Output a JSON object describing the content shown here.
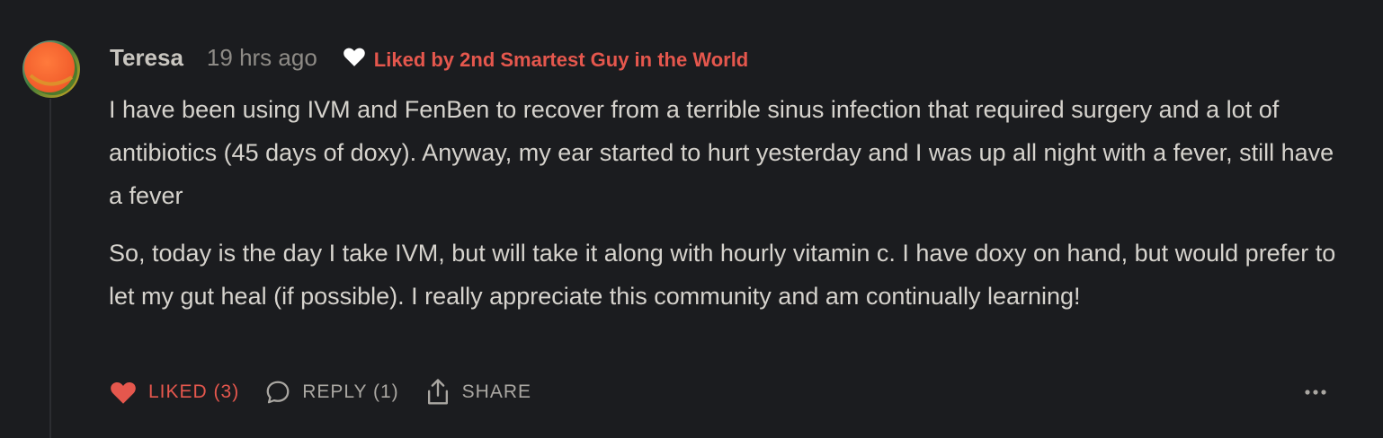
{
  "comment": {
    "author": "Teresa",
    "timestamp": "19 hrs ago",
    "liked_by": "Liked by 2nd Smartest Guy in the World",
    "paragraphs": [
      "I have been using IVM and FenBen to recover from a terrible sinus infection that required surgery and a lot of antibiotics (45 days of doxy). Anyway, my ear started to hurt yesterday and I was up all night with a fever, still have a fever",
      "So, today is the day I take IVM, but will take it along with hourly vitamin c. I have doxy on hand, but would prefer to let my gut heal (if possible). I really appreciate this community and am continually learning!"
    ]
  },
  "actions": {
    "like_label": "LIKED (3)",
    "reply_label": "REPLY (1)",
    "share_label": "SHARE"
  },
  "icons": {
    "avatar": "avatar-gradient-circle",
    "liked_by": "heart-outline-icon",
    "like": "heart-filled-icon",
    "reply": "speech-bubble-icon",
    "share": "share-upload-icon",
    "more": "ellipsis-icon"
  },
  "colors": {
    "background": "#1b1c1f",
    "accent_red": "#e5574d",
    "text": "#d6d3cd",
    "muted": "#8e8b86"
  }
}
